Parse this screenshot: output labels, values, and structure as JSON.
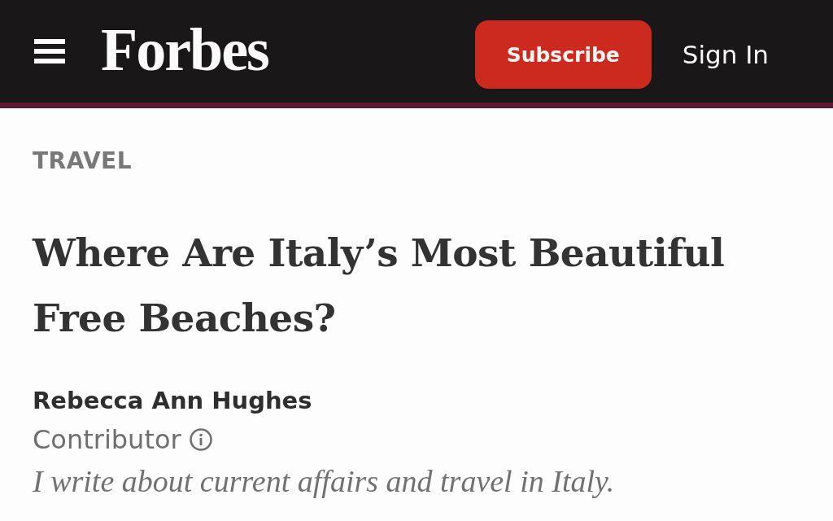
{
  "header": {
    "logo": "Forbes",
    "subscribe_button": "Subscribe",
    "sign_in_link": "Sign In"
  },
  "article": {
    "category": "TRAVEL",
    "title": "Where Are Italy’s Most Beautiful Free Beaches?",
    "author": {
      "name": "Rebecca Ann Hughes",
      "role": "Contributor",
      "bio": "I write about current affairs and travel in Italy."
    }
  }
}
